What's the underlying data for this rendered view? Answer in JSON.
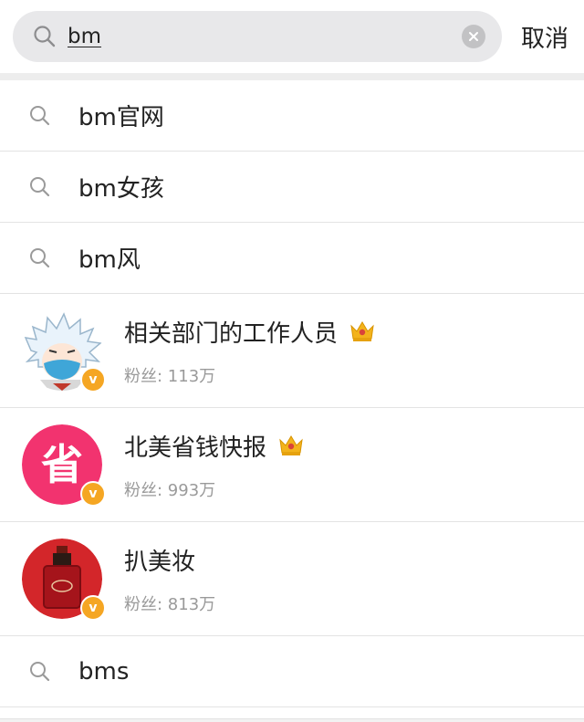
{
  "search": {
    "value": "bm",
    "cancel_label": "取消"
  },
  "suggestions_top": [
    {
      "text": "bm官网"
    },
    {
      "text": "bm女孩"
    },
    {
      "text": "bm风"
    }
  ],
  "users": [
    {
      "name": "相关部门的工作人员",
      "fans": "粉丝: 113万",
      "avatar": "anime-character-avatar",
      "crown": "crown-icon"
    },
    {
      "name": "北美省钱快报",
      "fans": "粉丝: 993万",
      "avatar": "pink-logo-avatar",
      "avatar_text": "省",
      "crown": "crown-icon"
    },
    {
      "name": "扒美妆",
      "fans": "粉丝: 813万",
      "avatar": "perfume-bottle-avatar"
    }
  ],
  "suggestions_bottom": [
    {
      "text": "bms"
    }
  ],
  "colors": {
    "verified": "#f5a623",
    "crown": "#f3b31c",
    "pink_logo": "#f2336f",
    "perfume_bg": "#d3262a"
  }
}
